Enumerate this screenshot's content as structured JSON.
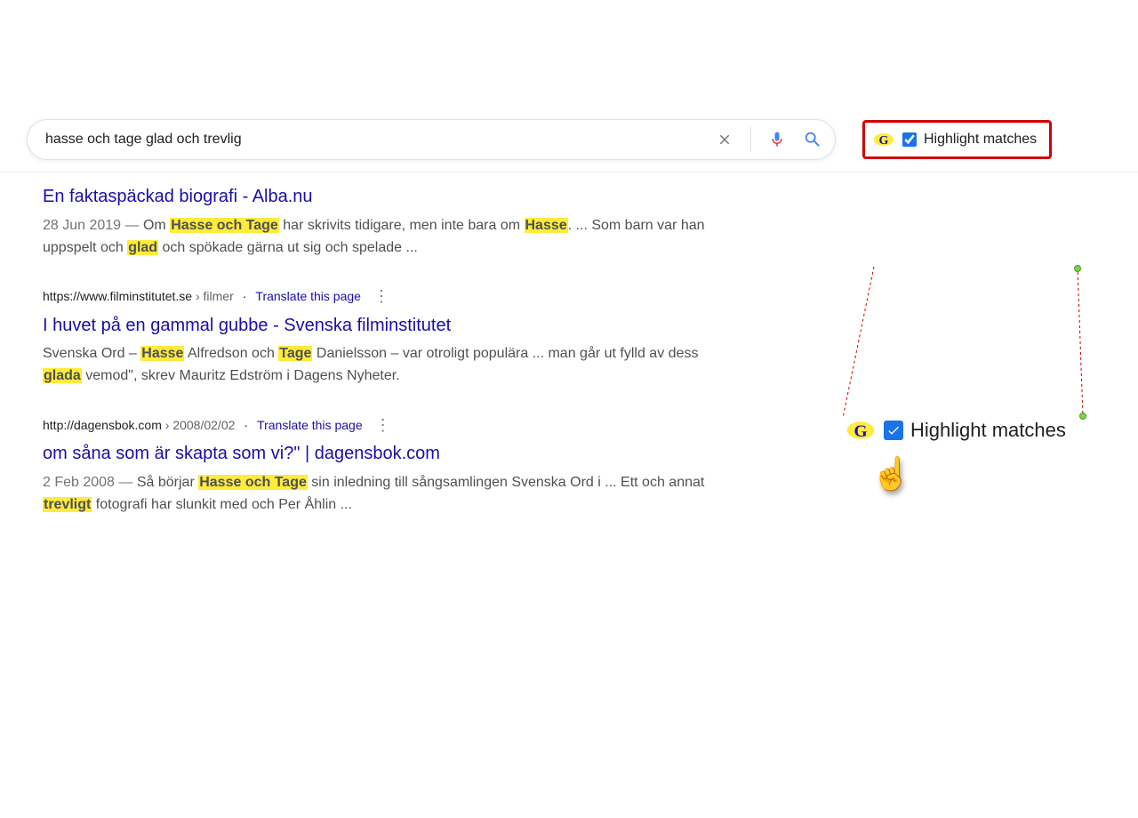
{
  "search": {
    "query": "hasse och tage glad och trevlig"
  },
  "extension": {
    "label": "Highlight matches",
    "checked": true
  },
  "callout": {
    "label": "Highlight matches"
  },
  "translate_label": "Translate this page",
  "results": [
    {
      "title": "En faktaspäckad biografi - Alba.nu",
      "date": "28 Jun 2019",
      "snippet_pre": "Om ",
      "hl1": "Hasse och Tage",
      "snippet_mid1": " har skrivits tidigare, men inte bara om ",
      "hl2": "Hasse",
      "snippet_mid2": ". ... Som barn var han uppspelt och ",
      "hl3": "glad",
      "snippet_post": " och spökade gärna ut sig och spelade ..."
    },
    {
      "url_host": "https://www.filminstitutet.se",
      "url_path": " › filmer",
      "title": "I huvet på en gammal gubbe - Svenska filminstitutet",
      "snippet_pre": "Svenska Ord – ",
      "hl1": "Hasse",
      "snippet_mid1": " Alfredson och ",
      "hl2": "Tage",
      "snippet_mid2": " Danielsson – var otroligt populära ... man går ut fylld av dess ",
      "hl3": "glada",
      "snippet_post": " vemod\", skrev Mauritz Edström i Dagens Nyheter."
    },
    {
      "url_host": "http://dagensbok.com",
      "url_path": " › 2008/02/02",
      "title": "om såna som är skapta som vi?\" | dagensbok.com",
      "date": "2 Feb 2008",
      "snippet_pre": "Så börjar ",
      "hl1": "Hasse och Tage",
      "snippet_mid1": " sin inledning till sångsamlingen Svenska Ord i ... Ett och annat ",
      "hl2": "trevligt",
      "snippet_post": " fotografi har slunkit med och Per Åhlin ..."
    }
  ]
}
